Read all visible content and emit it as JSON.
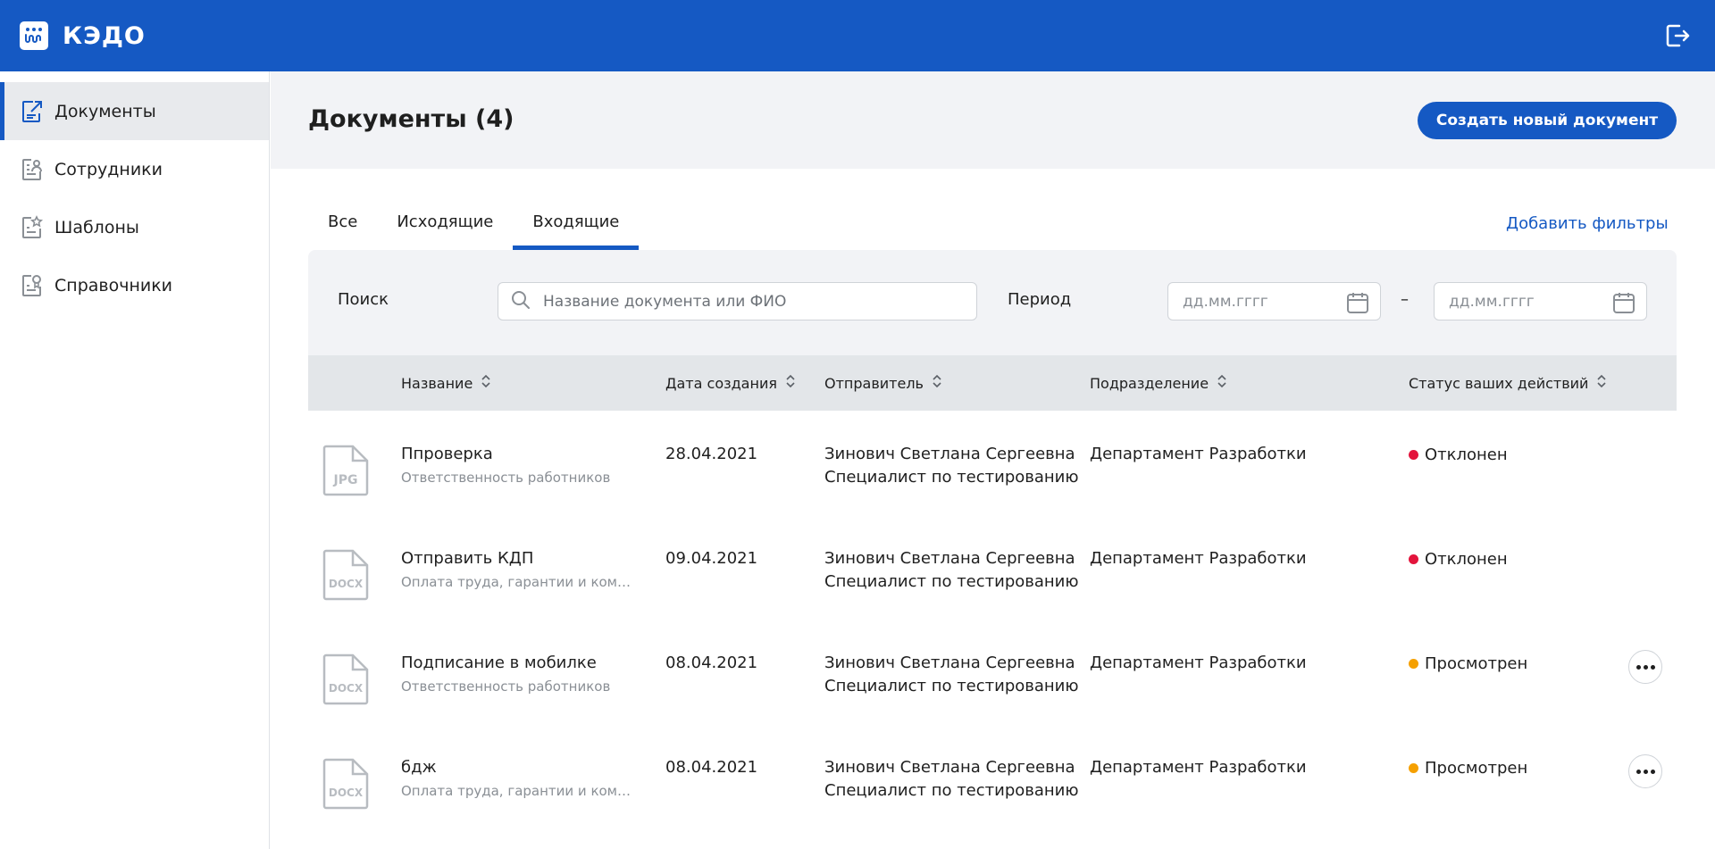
{
  "app": {
    "logo_text": "КЭДО"
  },
  "sidebar": {
    "items": [
      {
        "label": "Документы",
        "icon": "documents-icon",
        "active": true
      },
      {
        "label": "Сотрудники",
        "icon": "employees-icon",
        "active": false
      },
      {
        "label": "Шаблоны",
        "icon": "templates-icon",
        "active": false
      },
      {
        "label": "Справочники",
        "icon": "directories-icon",
        "active": false
      }
    ]
  },
  "main": {
    "title": "Документы (4)",
    "create_button": "Создать новый документ",
    "tabs": [
      {
        "label": "Все",
        "active": false
      },
      {
        "label": "Исходящие",
        "active": false
      },
      {
        "label": "Входящие",
        "active": true
      }
    ],
    "add_filters": "Добавить фильтры",
    "filters": {
      "search_label": "Поиск",
      "search_placeholder": "Название документа или ФИО",
      "period_label": "Период",
      "date_placeholder": "дд.мм.гггг",
      "dash": "–"
    },
    "columns": [
      "Название",
      "Дата создания",
      "Отправитель",
      "Подразделение",
      "Статус ваших действий"
    ],
    "rows": [
      {
        "file_type": "JPG",
        "name": "Ппроверка",
        "category": "Ответственность работников",
        "date": "28.04.2021",
        "sender_name": "Зинович Светлана Сергеевна",
        "sender_position": "Специалист по тестированию",
        "department": "Департамент Разработки",
        "status": "Отклонен",
        "status_color": "#e3143c",
        "has_menu": false
      },
      {
        "file_type": "DOCX",
        "name": "Отправить КДП",
        "category": "Оплата труда, гарантии и компе…",
        "date": "09.04.2021",
        "sender_name": "Зинович Светлана Сергеевна",
        "sender_position": "Специалист по тестированию",
        "department": "Департамент Разработки",
        "status": "Отклонен",
        "status_color": "#e3143c",
        "has_menu": false
      },
      {
        "file_type": "DOCX",
        "name": "Подписание в мобилке",
        "category": "Ответственность работников",
        "date": "08.04.2021",
        "sender_name": "Зинович Светлана Сергеевна",
        "sender_position": "Специалист по тестированию",
        "department": "Департамент Разработки",
        "status": "Просмотрен",
        "status_color": "#f5a000",
        "has_menu": true
      },
      {
        "file_type": "DOCX",
        "name": "бдж",
        "category": "Оплата труда, гарантии и компе…",
        "date": "08.04.2021",
        "sender_name": "Зинович Светлана Сергеевна",
        "sender_position": "Специалист по тестированию",
        "department": "Департамент Разработки",
        "status": "Просмотрен",
        "status_color": "#f5a000",
        "has_menu": true
      }
    ]
  },
  "colors": {
    "brand": "#1559c3",
    "rejected": "#e3143c",
    "viewed": "#f5a000"
  }
}
